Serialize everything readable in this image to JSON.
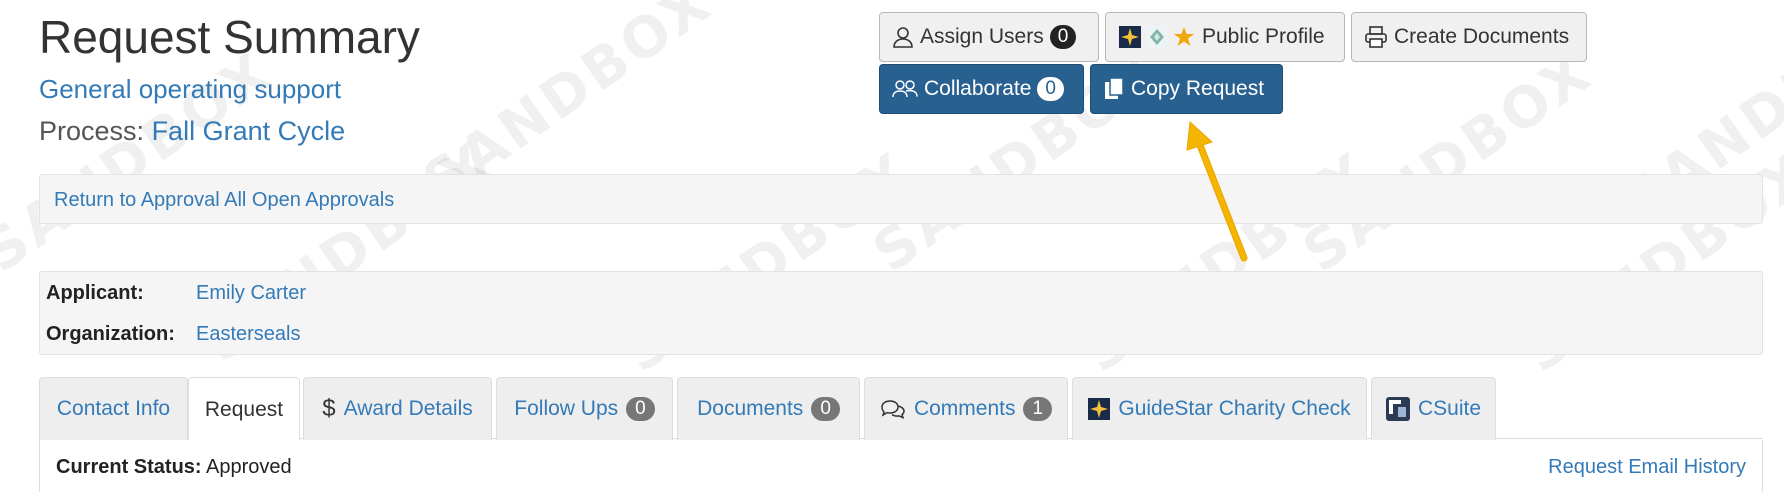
{
  "watermark": "SANDBOX",
  "header": {
    "title": "Request Summary",
    "subtitle": "General operating support",
    "process_label": "Process:",
    "process_value": "Fall Grant Cycle"
  },
  "toolbar": {
    "assign_users_label": "Assign Users",
    "assign_users_count": "0",
    "public_profile_label": "Public Profile",
    "create_documents_label": "Create Documents",
    "collaborate_label": "Collaborate",
    "collaborate_count": "0",
    "copy_request_label": "Copy Request"
  },
  "nav_well": {
    "return_link": "Return to Approval All Open Approvals"
  },
  "applicant_well": {
    "applicant_label": "Applicant:",
    "applicant_value": "Emily Carter",
    "organization_label": "Organization:",
    "organization_value": "Easterseals"
  },
  "tabs": [
    {
      "label": "Contact Info"
    },
    {
      "label": "Request"
    },
    {
      "label": "Award Details"
    },
    {
      "label": "Follow Ups",
      "count": "0"
    },
    {
      "label": "Documents",
      "count": "0"
    },
    {
      "label": "Comments",
      "count": "1"
    },
    {
      "label": "GuideStar Charity Check"
    },
    {
      "label": "CSuite"
    }
  ],
  "content": {
    "status_label": "Current Status:",
    "status_value": "Approved",
    "email_history_link": "Request Email History"
  },
  "colors": {
    "link": "#337ab7",
    "primary": "#286090",
    "annotation_arrow": "#f5b400"
  },
  "icons": {
    "assign_users": "user-icon",
    "public_profile": "guidestar-badges-icon",
    "create_documents": "printer-icon",
    "collaborate": "users-icon",
    "copy_request": "copy-icon",
    "award_details": "dollar-icon",
    "comments": "comments-icon",
    "guidestar": "guidestar-icon",
    "csuite": "csuite-icon"
  }
}
